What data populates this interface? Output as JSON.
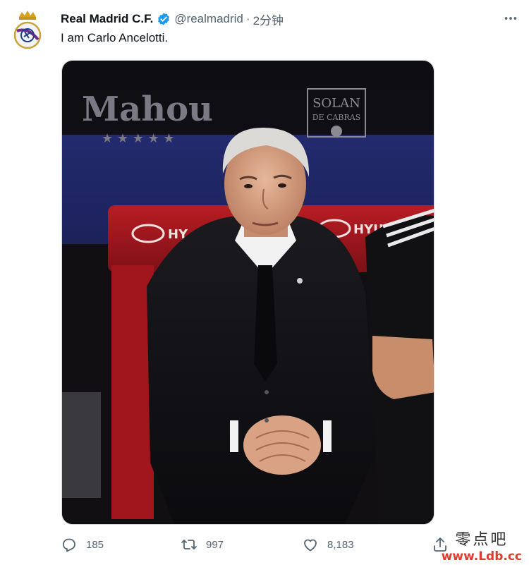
{
  "tweet": {
    "author": {
      "display_name": "Real Madrid C.F.",
      "handle": "@realmadrid",
      "verified": true,
      "avatar_icon": "real-madrid-crest-icon"
    },
    "separator": "·",
    "time": "2分钟",
    "text": "I am Carlo Ancelotti.",
    "more_icon": "more-icon",
    "media": {
      "type": "photo",
      "signage": {
        "left": "Mahou",
        "right_top": "SOLAN",
        "right_bottom": "DE CABRAS",
        "seat_brand": "HYUNDAI"
      }
    },
    "actions": {
      "replies": {
        "count": "185",
        "icon": "reply-icon"
      },
      "retweets": {
        "count": "997",
        "icon": "retweet-icon"
      },
      "likes": {
        "count": "8,183",
        "icon": "like-icon"
      },
      "share": {
        "icon": "share-icon"
      }
    }
  },
  "watermark": {
    "cn": "零点吧",
    "url": "www.Ldb.cc"
  },
  "colors": {
    "verified": "#1d9bf0",
    "text": "#0f1419",
    "muted": "#536471"
  }
}
